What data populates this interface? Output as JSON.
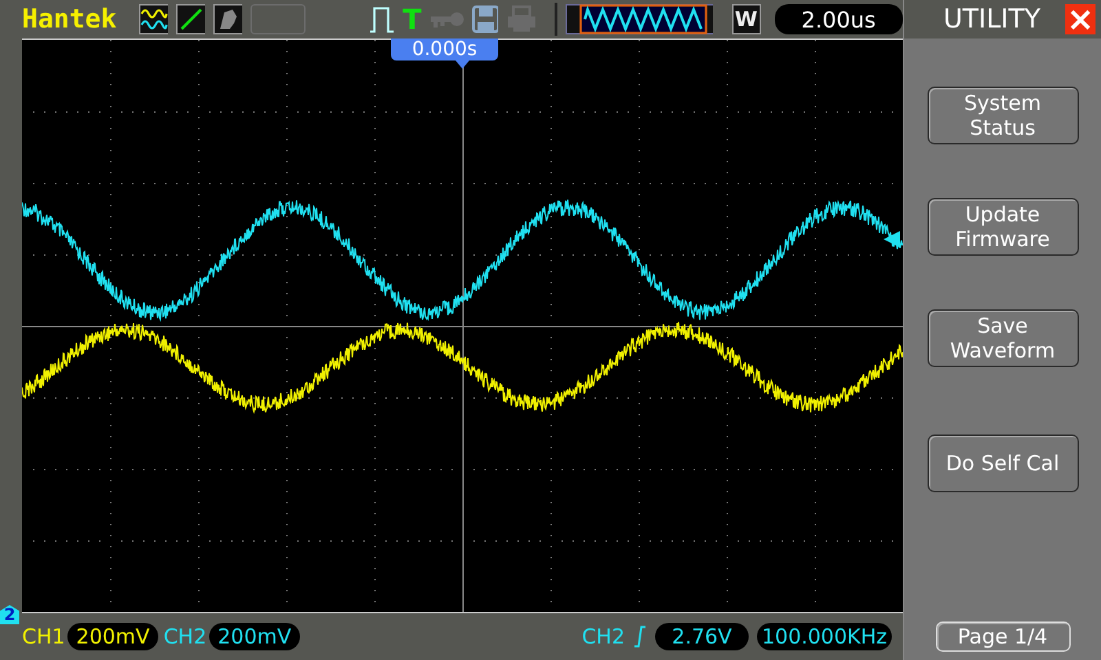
{
  "brand": "Hantek",
  "top_bar": {
    "trigger_status": "T",
    "timebase_mode": "W",
    "timebase": "2.00us",
    "trigger_position": "0.000s"
  },
  "screen": {
    "channel_marker": "2"
  },
  "menu": {
    "title": "UTILITY",
    "close": "×",
    "buttons": [
      {
        "lines": [
          "System",
          "Status"
        ]
      },
      {
        "lines": [
          "Update",
          "Firmware"
        ]
      },
      {
        "lines": [
          "Save",
          "Waveform"
        ]
      },
      {
        "lines": [
          "Do Self Cal"
        ]
      }
    ],
    "page": "Page 1/4"
  },
  "channels": [
    {
      "name": "CH1",
      "scale": "200mV",
      "color": "#f0f000"
    },
    {
      "name": "CH2",
      "scale": "200mV",
      "color": "#20e0f0"
    }
  ],
  "trigger": {
    "source": "CH2",
    "level": "2.76V",
    "frequency": "100.000KHz"
  }
}
